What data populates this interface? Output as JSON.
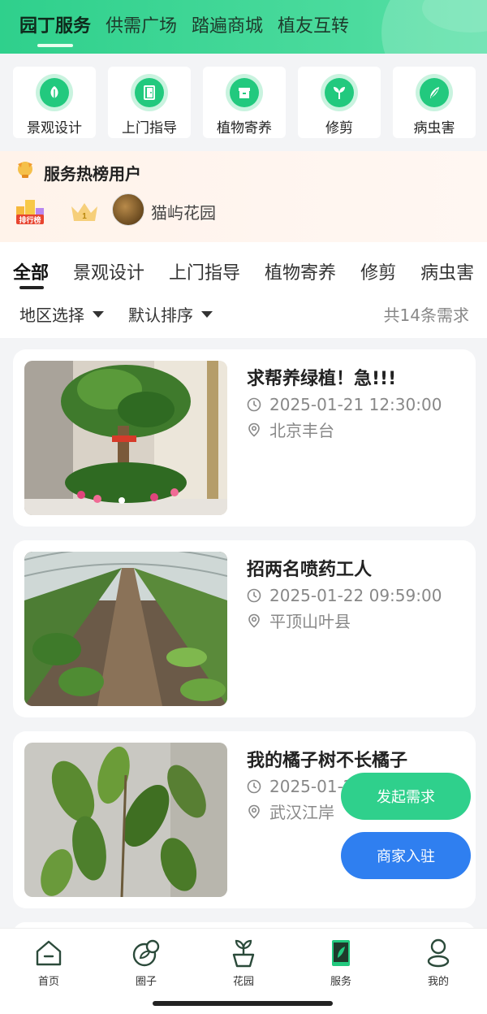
{
  "header": {
    "tabs": [
      {
        "label": "园丁服务",
        "active": true
      },
      {
        "label": "供需广场",
        "active": false
      },
      {
        "label": "踏遍商城",
        "active": false
      },
      {
        "label": "植友互转",
        "active": false
      }
    ]
  },
  "categories": [
    {
      "label": "景观设计",
      "icon": "leaf-icon"
    },
    {
      "label": "上门指导",
      "icon": "door-icon"
    },
    {
      "label": "植物寄养",
      "icon": "box-icon"
    },
    {
      "label": "修剪",
      "icon": "sprout-icon"
    },
    {
      "label": "病虫害",
      "icon": "bug-icon"
    }
  ],
  "hot_users": {
    "title": "服务热榜用户",
    "rank_badge_text": "排行榜",
    "crown_number": "1",
    "top_user": "猫屿花园"
  },
  "filter": {
    "tabs": [
      "全部",
      "景观设计",
      "上门指导",
      "植物寄养",
      "修剪",
      "病虫害"
    ],
    "active_tab": "全部",
    "region_label": "地区选择",
    "sort_label": "默认排序",
    "count_text": "共14条需求"
  },
  "cards": [
    {
      "title": "求帮养绿植！急!!!",
      "time": "2025-01-21 12:30:00",
      "location": "北京丰台",
      "image": "potted-tree-photo"
    },
    {
      "title": "招两名喷药工人",
      "time": "2025-01-22 09:59:00",
      "location": "平顶山叶县",
      "image": "greenhouse-photo"
    },
    {
      "title": "我的橘子树不长橘子",
      "time": "2025-01-2",
      "location": "武汉江岸",
      "image": "orange-tree-photo"
    }
  ],
  "fabs": {
    "post_demand": "发起需求",
    "merchant_join": "商家入驻"
  },
  "bottom_nav": [
    {
      "label": "首页",
      "icon": "home-icon"
    },
    {
      "label": "圈子",
      "icon": "circle-icon"
    },
    {
      "label": "花园",
      "icon": "garden-icon"
    },
    {
      "label": "服务",
      "icon": "service-icon"
    },
    {
      "label": "我的",
      "icon": "profile-icon"
    }
  ],
  "colors": {
    "brand_green": "#2fd08c",
    "brand_blue": "#2f7ff0",
    "icon_green": "#22c97e"
  }
}
